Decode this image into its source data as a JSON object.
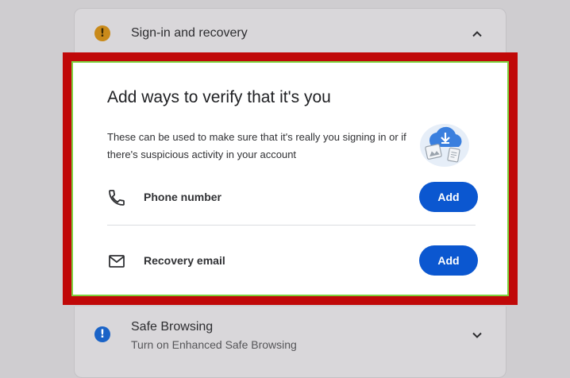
{
  "sections": {
    "signin": {
      "title": "Sign-in and recovery",
      "status_icon": "warning-icon",
      "status_color": "#c98a1a",
      "expanded": true
    },
    "safe_browsing": {
      "title": "Safe Browsing",
      "subtitle": "Turn on Enhanced Safe Browsing",
      "status_icon": "info-icon",
      "status_color": "#1a63c7",
      "expanded": false
    }
  },
  "verify_panel": {
    "title": "Add ways to verify that it's you",
    "description": "These can be used to make sure that it's really you signing in or if there's suspicious activity in your account",
    "illustration": "cloud-upload-illustration",
    "highlight_color": "#c00808",
    "methods": [
      {
        "label": "Phone number",
        "icon": "phone-icon",
        "button": "Add"
      },
      {
        "label": "Recovery email",
        "icon": "mail-icon",
        "button": "Add"
      }
    ],
    "accent_color": "#0b57d0"
  }
}
